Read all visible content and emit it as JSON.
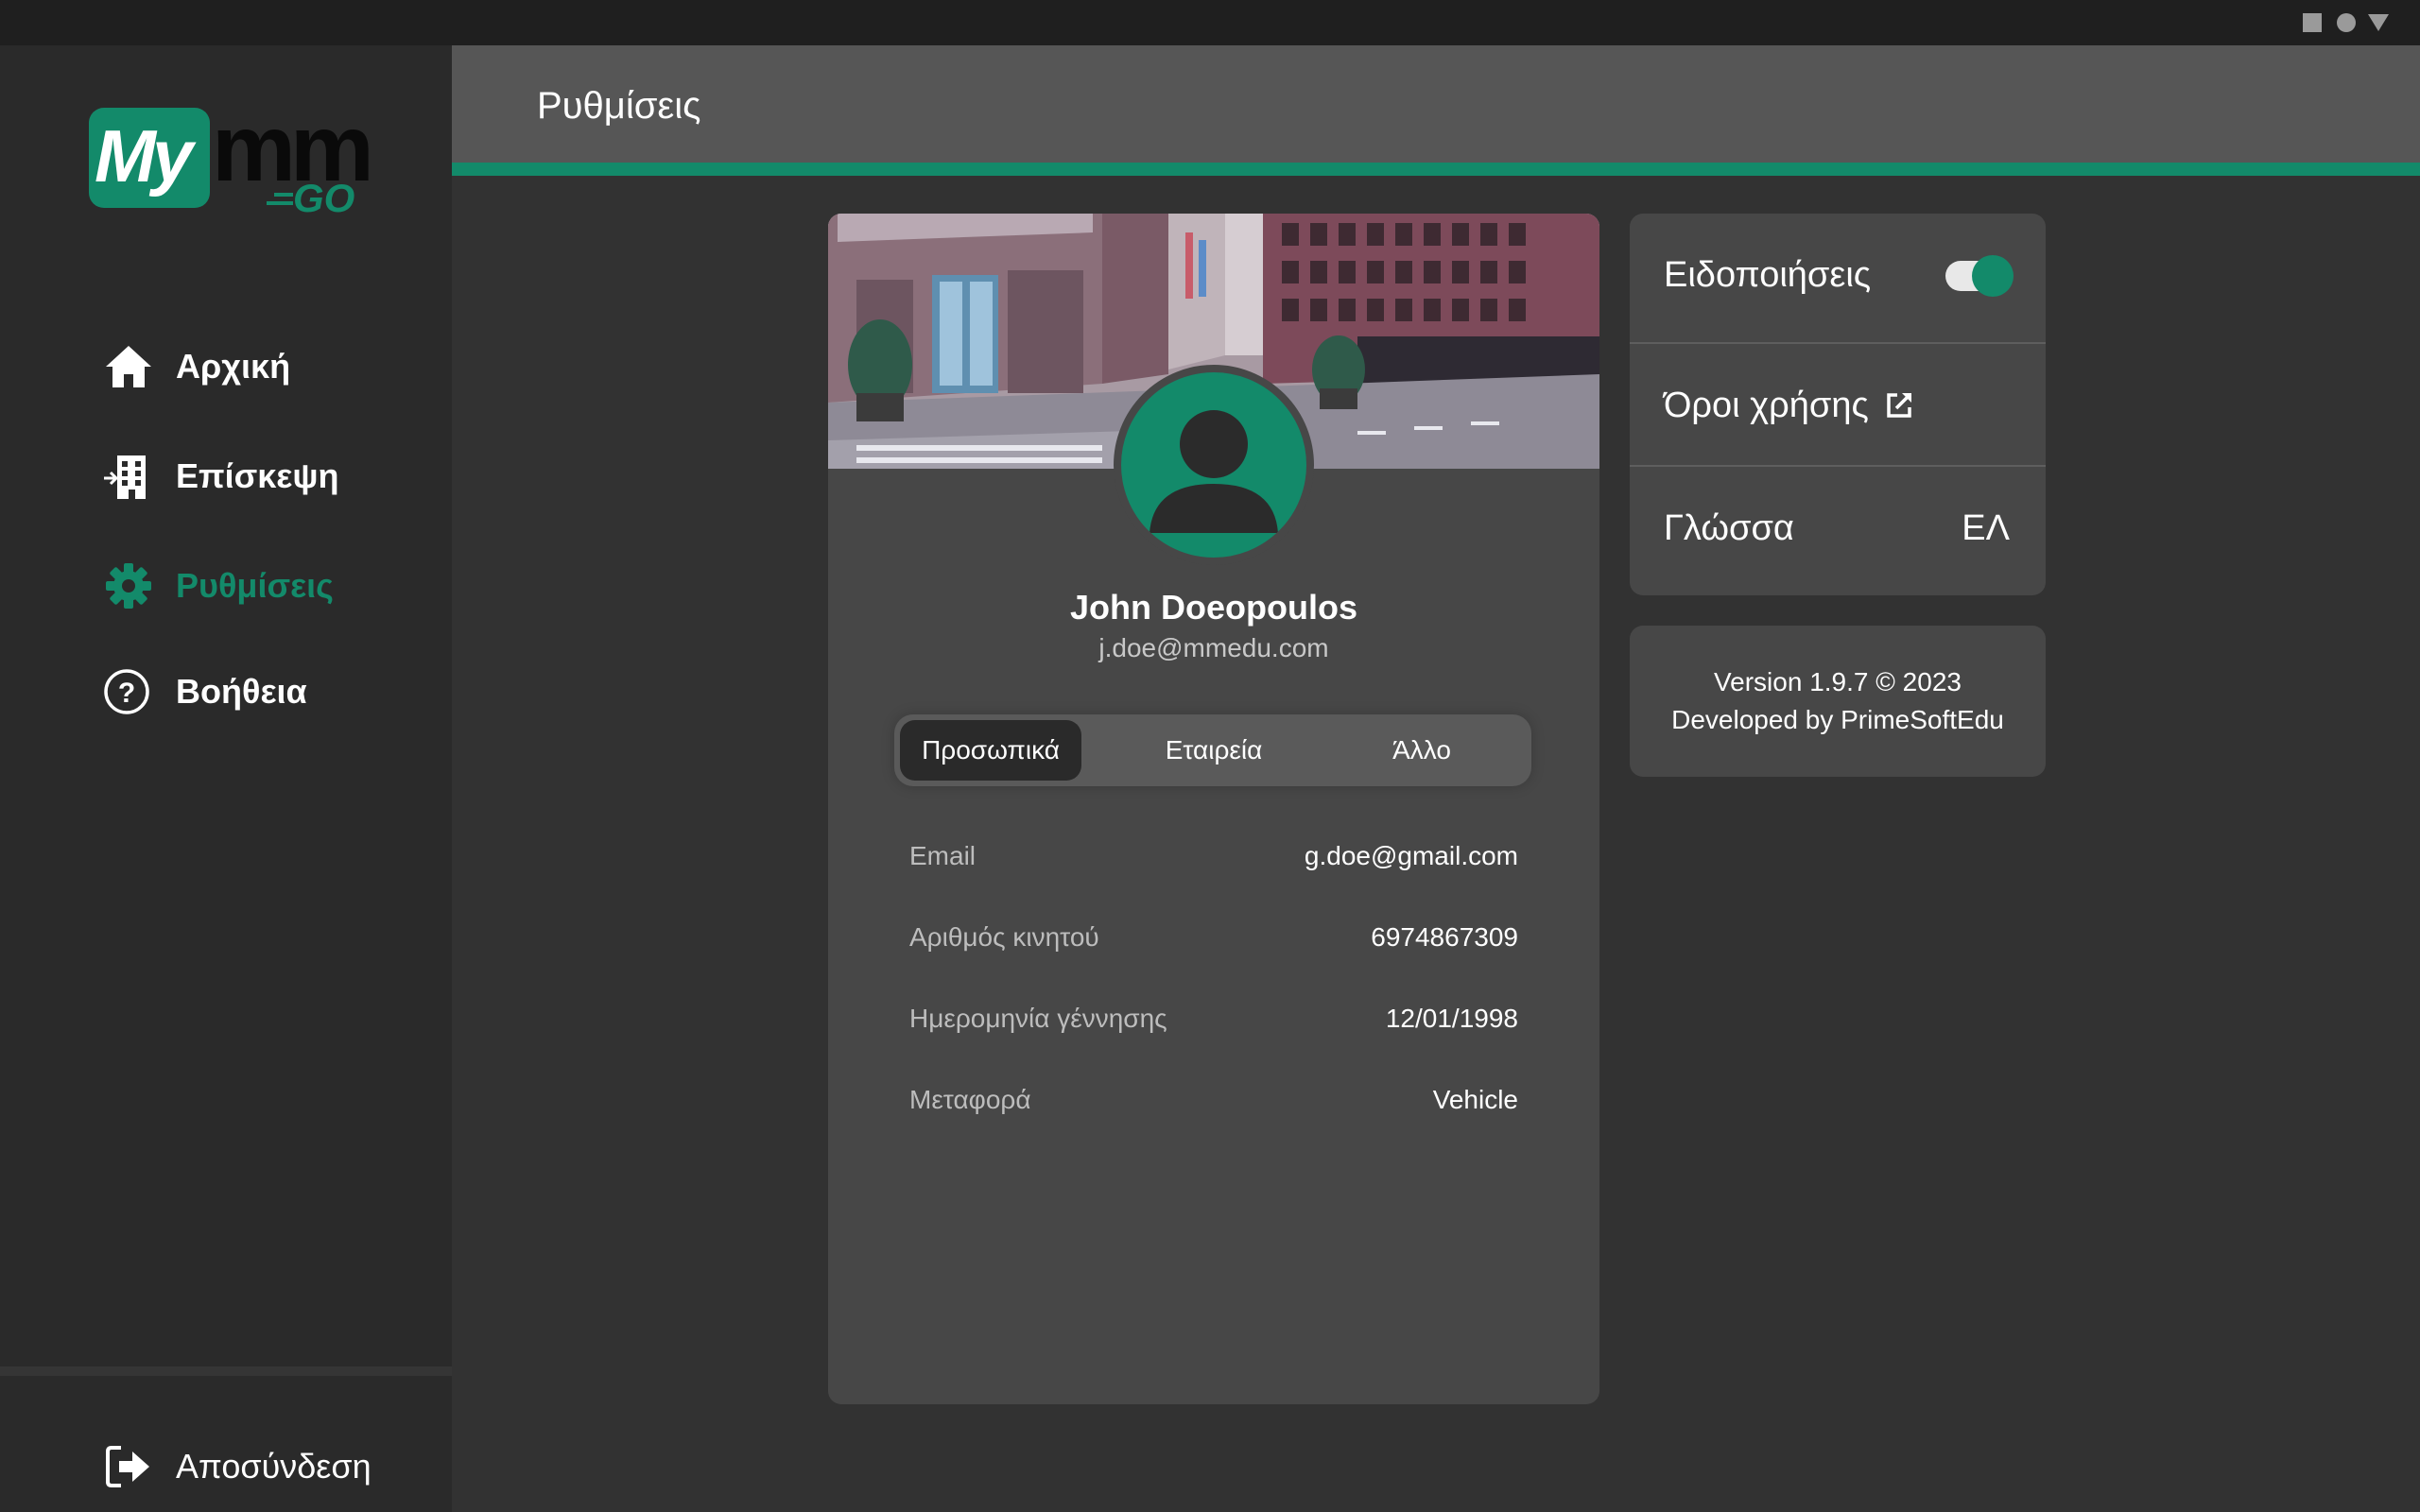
{
  "system_bar": {
    "icons": [
      "square-icon",
      "circle-icon",
      "triangle-icon"
    ]
  },
  "logo": {
    "my": "My",
    "mm": "mm",
    "go": "GO"
  },
  "sidebar": {
    "items": [
      {
        "label": "Αρχική",
        "icon": "home-icon"
      },
      {
        "label": "Επίσκεψη",
        "icon": "building-enter-icon"
      },
      {
        "label": "Ρυθμίσεις",
        "icon": "gear-icon",
        "active": true
      },
      {
        "label": "Βοήθεια",
        "icon": "help-circle-icon"
      }
    ],
    "logout_label": "Αποσύνδεση"
  },
  "header": {
    "title": "Ρυθμίσεις"
  },
  "profile": {
    "name": "John Doeopoulos",
    "email": "j.doe@mmedu.com",
    "tabs": [
      {
        "label": "Προσωπικά",
        "active": true
      },
      {
        "label": "Εταιρεία"
      },
      {
        "label": "Άλλο"
      }
    ],
    "fields": [
      {
        "label": "Email",
        "value": "g.doe@gmail.com"
      },
      {
        "label": "Αριθμός κινητού",
        "value": "6974867309"
      },
      {
        "label": "Ημερομηνία γέννησης",
        "value": "12/01/1998"
      },
      {
        "label": "Μεταφορά",
        "value": "Vehicle"
      }
    ]
  },
  "settings": {
    "notifications_label": "Ειδοποιήσεις",
    "notifications_on": true,
    "terms_label": "Όροι χρήσης",
    "language_label": "Γλώσσα",
    "language_value": "ΕΛ"
  },
  "footer_info": {
    "version": "Version 1.9.7 © 2023",
    "developer": "Developed by PrimeSoftEdu"
  },
  "colors": {
    "accent": "#138a6a",
    "sidebar": "#2a2a2a",
    "header": "#565656",
    "card": "#474747",
    "background": "#323232"
  }
}
